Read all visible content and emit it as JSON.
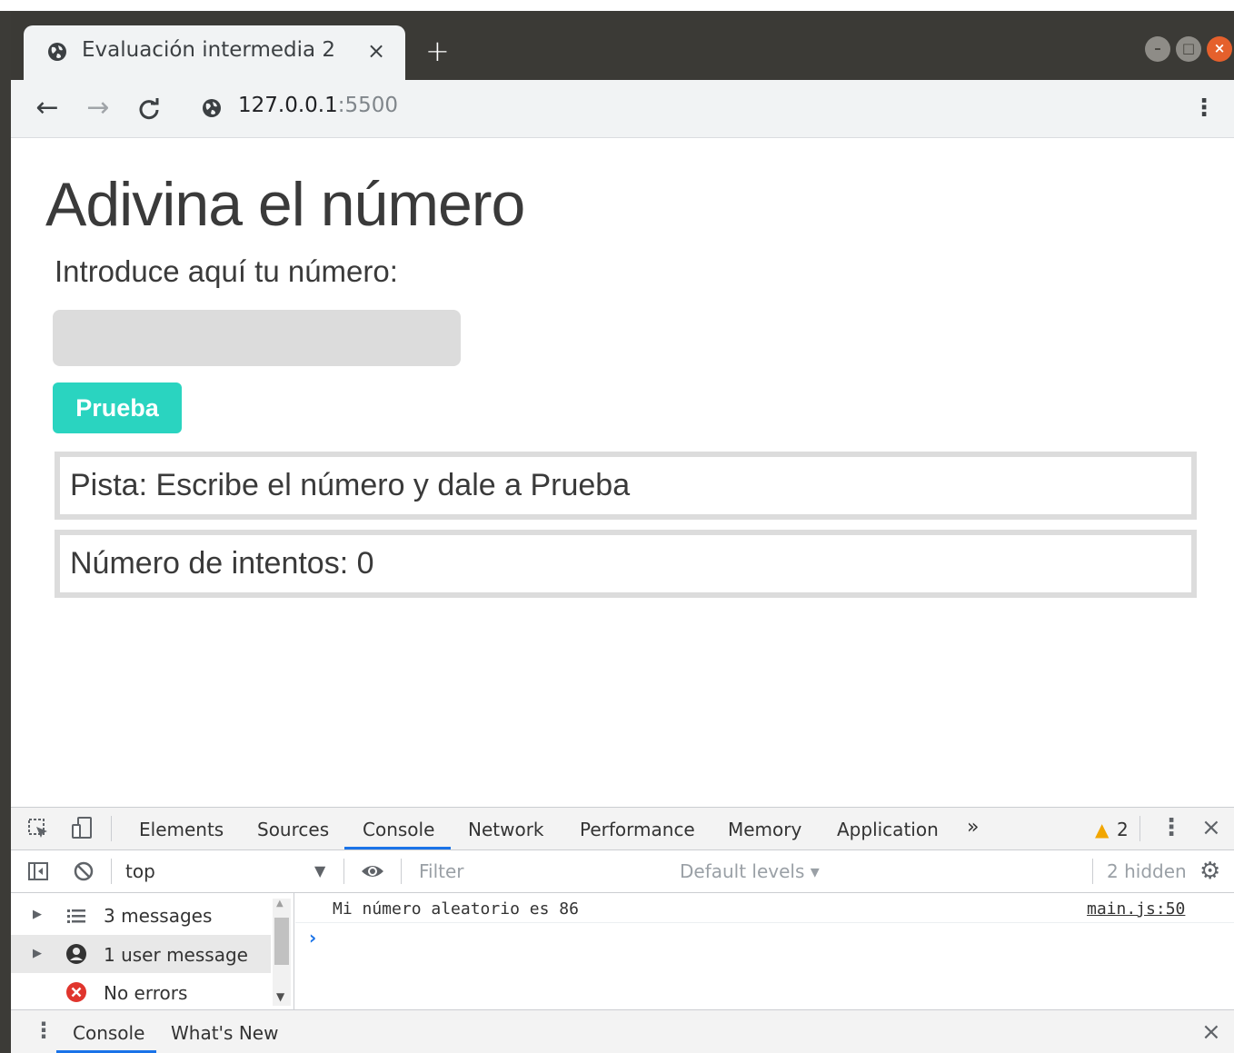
{
  "browser": {
    "tab_title": "Evaluación intermedia 2",
    "tab_close": "×",
    "new_tab": "+",
    "url_host": "127.0.0.1",
    "url_port": ":5500",
    "nav": {
      "back": "←",
      "forward": "→",
      "reload": "C"
    },
    "menu": "⋮",
    "window_buttons": {
      "minimize": "–",
      "maximize": "□",
      "close": "×"
    }
  },
  "page": {
    "title": "Adivina el número",
    "prompt_label": "Introduce aquí tu número:",
    "input_value": "",
    "button_label": "Prueba",
    "hint": "Pista: Escribe el número y dale a Prueba",
    "attempts": "Número de intentos: 0",
    "colors": {
      "button": "#2ad4c0",
      "input_bg": "#dcdcdc",
      "box_border": "#dcdcdc"
    }
  },
  "devtools": {
    "tabs": [
      "Elements",
      "Sources",
      "Console",
      "Network",
      "Performance",
      "Memory",
      "Application"
    ],
    "more_tabs": "»",
    "active_tab": "Console",
    "warnings_count": "2",
    "context": "top",
    "filter_placeholder": "Filter",
    "levels": "Default levels ▾",
    "hidden": "2 hidden",
    "sidebar": [
      {
        "label": "3 messages",
        "icon": "list-icon",
        "expandable": true,
        "selected": false
      },
      {
        "label": "1 user message",
        "icon": "user-icon",
        "expandable": true,
        "selected": true
      },
      {
        "label": "No errors",
        "icon": "error-icon",
        "expandable": false,
        "selected": false
      }
    ],
    "log": {
      "message": "Mi número aleatorio es 86",
      "source": "main.js:50"
    },
    "prompt": "›",
    "drawer_tabs": [
      "Console",
      "What's New"
    ],
    "close": "×",
    "accent": "#1a73e8"
  }
}
